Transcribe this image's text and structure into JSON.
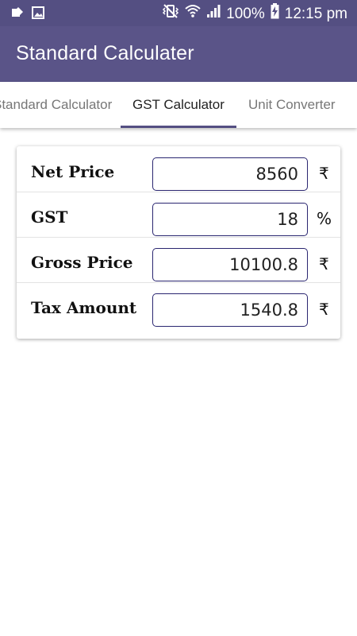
{
  "status_bar": {
    "battery_percent": "100%",
    "time": "12:15 pm",
    "icons_left": [
      "notification-icon",
      "image-icon"
    ],
    "icons_right": [
      "vibrate-mute-icon",
      "wifi-icon",
      "signal-icon",
      "battery-charging-icon"
    ]
  },
  "app_bar": {
    "title": "Standard Calculater",
    "background": "#5a5488"
  },
  "tabs": [
    {
      "label": "Standard Calculator",
      "active": false
    },
    {
      "label": "GST Calculator",
      "active": true
    },
    {
      "label": "Unit Converter",
      "active": false
    }
  ],
  "form": {
    "net_price": {
      "label": "Net Price",
      "value": "8560",
      "unit": "₹"
    },
    "gst": {
      "label": "GST",
      "value": "18",
      "unit": "%"
    },
    "gross_price": {
      "label": "Gross Price",
      "value": "10100.8",
      "unit": "₹"
    },
    "tax_amount": {
      "label": "Tax Amount",
      "value": "1540.8",
      "unit": "₹"
    }
  },
  "colors": {
    "primary": "#544f82",
    "input_border": "#2a2670"
  }
}
